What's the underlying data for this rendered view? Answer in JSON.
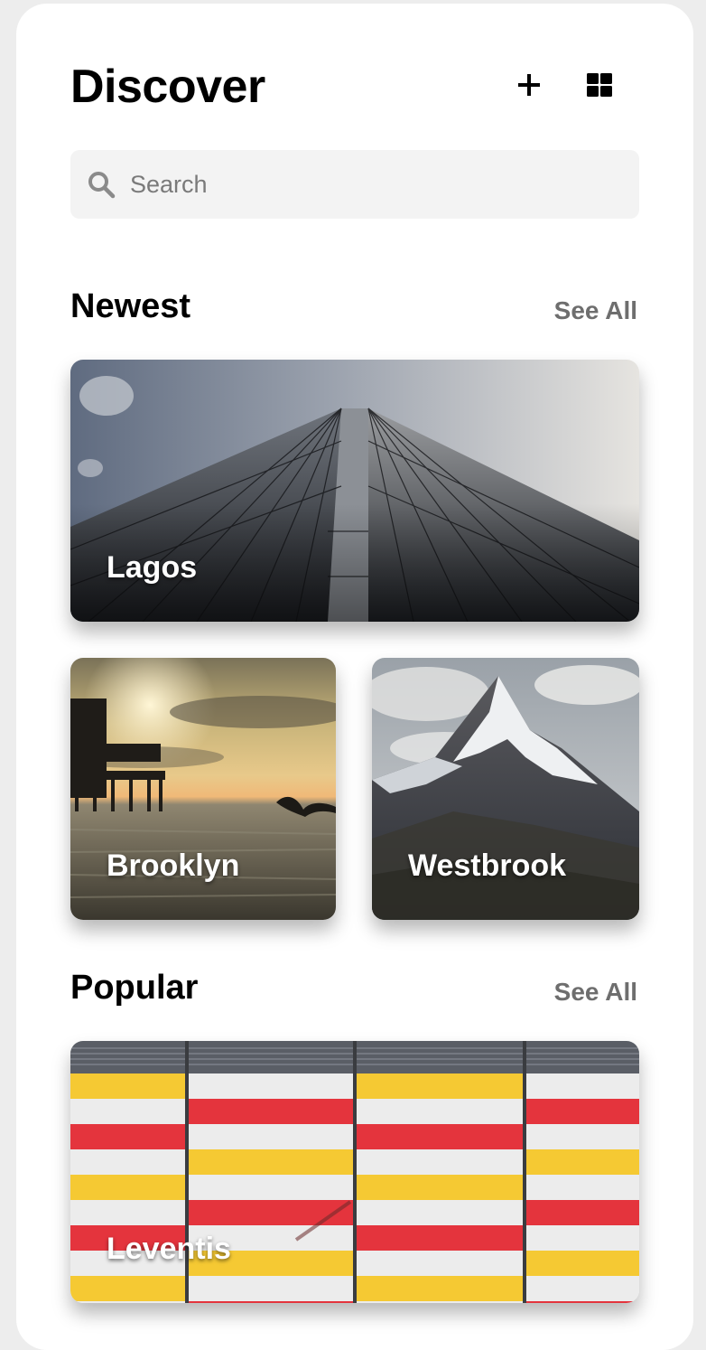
{
  "header": {
    "title": "Discover",
    "add_icon": "plus-icon",
    "view_icon": "grid-icon"
  },
  "search": {
    "placeholder": "Search",
    "icon": "search-icon"
  },
  "sections": {
    "newest": {
      "title": "Newest",
      "see_all": "See All",
      "cards": [
        {
          "label": "Lagos",
          "image": "skyscraper-photo"
        },
        {
          "label": "Brooklyn",
          "image": "pier-sunset-photo"
        },
        {
          "label": "Westbrook",
          "image": "mountain-photo"
        }
      ]
    },
    "popular": {
      "title": "Popular",
      "see_all": "See All",
      "cards": [
        {
          "label": "Leventis",
          "image": "striped-wall-photo"
        }
      ]
    }
  },
  "colors": {
    "background": "#ededed",
    "panel": "#ffffff",
    "search_bg": "#f3f3f3",
    "muted_text": "#6e6e6e",
    "stripe_red": "#e4343d",
    "stripe_yellow": "#f5c933"
  }
}
